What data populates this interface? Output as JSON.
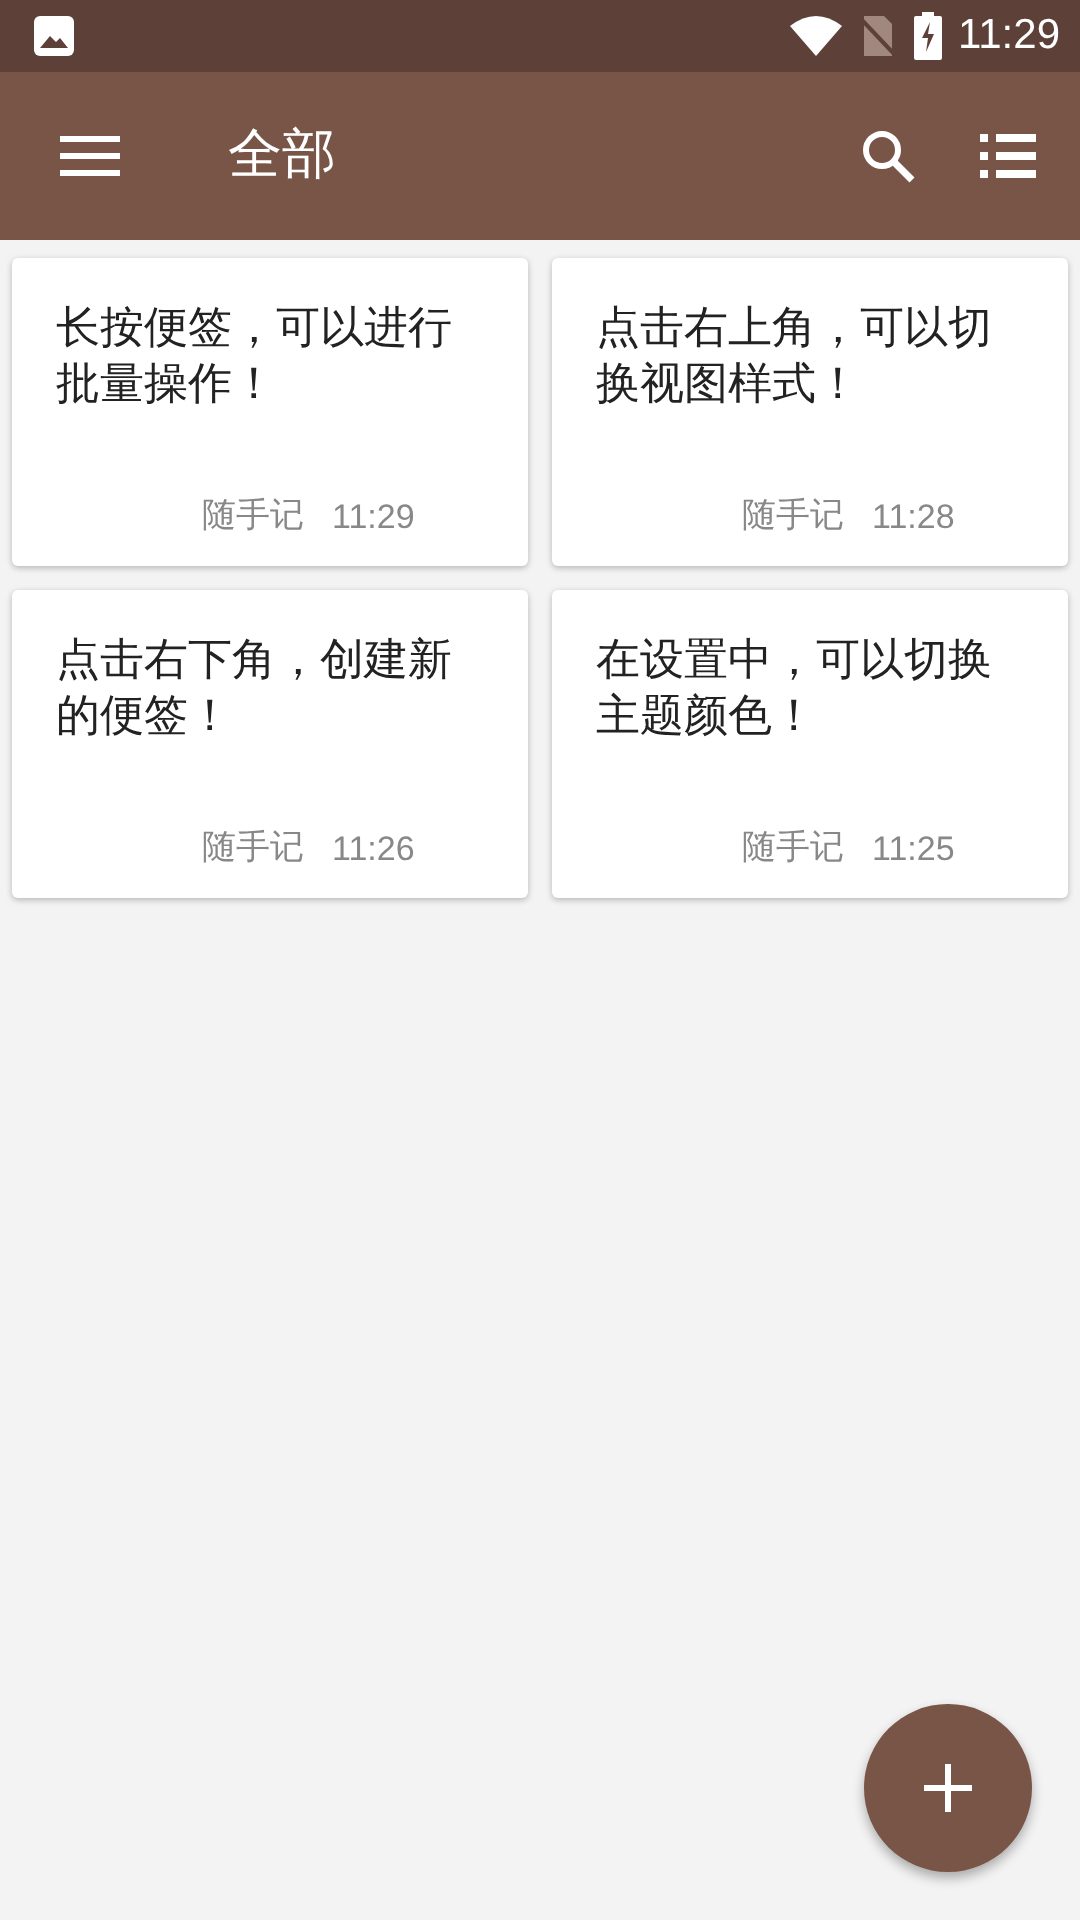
{
  "status_bar": {
    "time": "11:29"
  },
  "toolbar": {
    "title": "全部"
  },
  "notes": [
    {
      "text": "长按便签，可以进行批量操作！",
      "source": "随手记",
      "time": "11:29"
    },
    {
      "text": "点击右上角，可以切换视图样式！",
      "source": "随手记",
      "time": "11:28"
    },
    {
      "text": "点击右下角，创建新的便签！",
      "source": "随手记",
      "time": "11:26"
    },
    {
      "text": "在设置中，可以切换主题颜色！",
      "source": "随手记",
      "time": "11:25"
    }
  ]
}
